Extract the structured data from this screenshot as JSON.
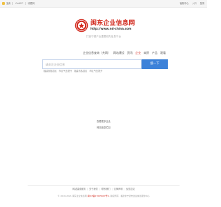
{
  "topbar": {
    "left": [
      "宝典",
      "OnHPC",
      "收藏网"
    ],
    "right": [
      "客服中心",
      "入口",
      "登录"
    ]
  },
  "logo": {
    "title": "闽东企业信息网",
    "url": "http://www.nd-china.com",
    "slogan": "打造宁德产业重要领先信息平台",
    "colors": {
      "brand": "#d22a1e"
    }
  },
  "nav": {
    "items": [
      "企业信息查询（共网）",
      "网站建设",
      "资讯",
      "企业",
      "商贸",
      "产品",
      "观看"
    ],
    "active_index": 3
  },
  "search": {
    "placeholder": "请关注企业信息",
    "button_label": "搜一下",
    "hot": [
      "福建省各县区",
      "市区气压提升",
      "福建省各县区",
      "市区气压提升"
    ],
    "colors": {
      "button": "#3d82d9"
    }
  },
  "middle": {
    "link1": "查看更多企业",
    "link2": "网站信息栏目"
  },
  "footer": {
    "links": [
      "网站建设服务",
      "关于我们",
      "联系我们",
      "法律声明",
      "反馈意见"
    ],
    "copyright_prefix": "© 2016-2021 闽东企业信息网",
    "icp": "闽ICP备17005607号-1",
    "copyright_suffix": "版权所有 · 福建省宁德市企业信息服务中心"
  }
}
